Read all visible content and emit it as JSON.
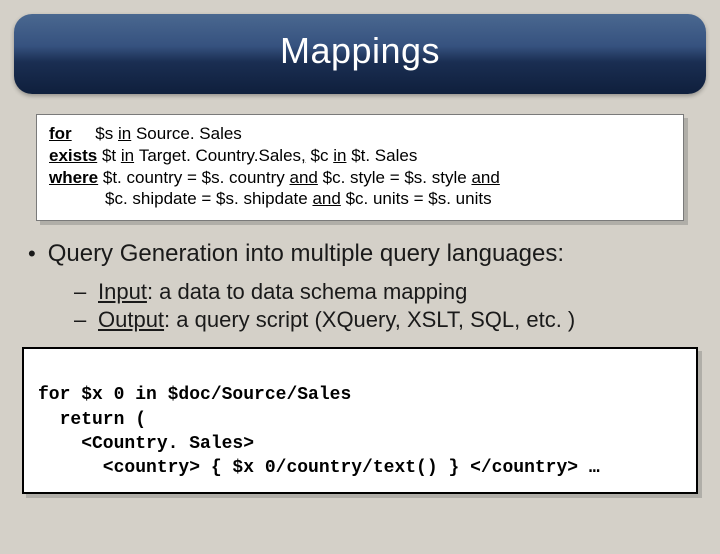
{
  "title": "Mappings",
  "mapping": {
    "for_kw": "for",
    "for_var": "$s",
    "in_kw": "in",
    "for_src": "Source. Sales",
    "exists_kw": "exists",
    "exists_var": "$t",
    "exists_in1": "Target. Country.Sales",
    "comma": ",",
    "exists_var2": "$c",
    "exists_in2": "$t. Sales",
    "where_kw": "where",
    "where1a": "$t. country = $s. country",
    "and_kw": "and",
    "where1b": "$c. style = $s. style",
    "where2a": "$c. shipdate = $s. shipdate",
    "where2b": "$c. units = $s. units"
  },
  "bullet": {
    "main": "Query Generation into multiple query languages:",
    "sub1_label": "Input",
    "sub1_rest": ": a data to data schema mapping",
    "sub2_label": "Output",
    "sub2_rest": ": a query script (XQuery, XSLT, SQL, etc. )"
  },
  "code": {
    "l1": "for $x 0 in $doc/Source/Sales",
    "l2": "  return (",
    "l3": "    <Country. Sales>",
    "l4": "      <country> { $x 0/country/text() } </country> …"
  }
}
